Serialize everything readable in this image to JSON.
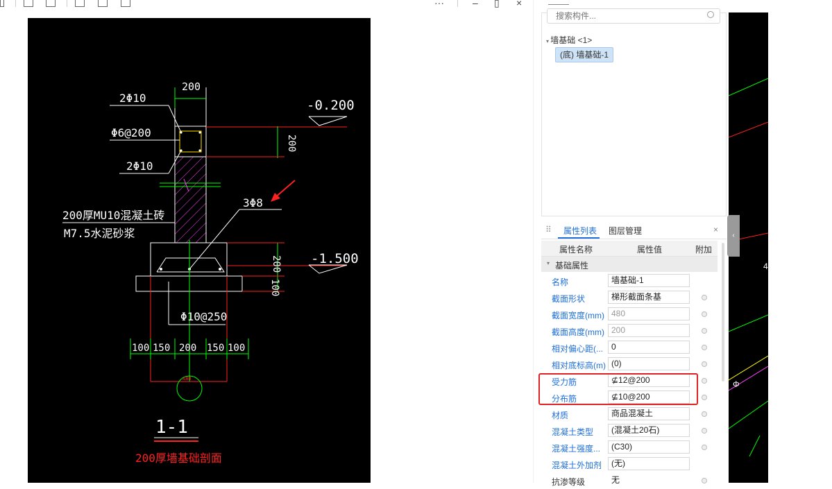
{
  "window": {
    "more": "···",
    "minimize": "–",
    "maximize": "▯",
    "close": "×"
  },
  "drawing": {
    "dim_top": "200",
    "rebar_top": "2Φ10",
    "stirrup": "Φ6@200",
    "rebar_bottom": "2Φ10",
    "elev_top": "-0.200",
    "dim_beam": "200",
    "wall_label_1": "200厚MU10混凝土砖",
    "wall_label_2": "M7.5水泥砂浆",
    "rebar_3": "3Φ8",
    "elev_bottom": "-1.500",
    "dim_footing": "200",
    "dim_cushion": "100",
    "bottom_rebar": "Φ10@250",
    "dims_bottom": [
      "100",
      "150",
      "200",
      "150",
      "100"
    ],
    "section_mark": "1-1",
    "caption": "200厚墙基础剖面",
    "circle_label": "A88"
  },
  "component_panel": {
    "search_placeholder": "搜索构件...",
    "tree_root": "墙基础 <1>",
    "tree_child": "(底) 墙基础-1"
  },
  "props_panel": {
    "tabs": [
      "属性列表",
      "图层管理"
    ],
    "close": "×",
    "columns": [
      "属性名称",
      "属性值",
      "附加"
    ],
    "group": "基础属性",
    "rows": [
      {
        "name": "名称",
        "value": "墙基础-1",
        "dot": false
      },
      {
        "name": "截面形状",
        "value": "梯形截面条基",
        "dot": true
      },
      {
        "name": "截面宽度(mm)",
        "value": "480",
        "dot": true
      },
      {
        "name": "截面高度(mm)",
        "value": "200",
        "dot": true
      },
      {
        "name": "相对偏心距(...",
        "value": "0",
        "dot": true
      },
      {
        "name": "相对底标高(m)",
        "value": "(0)",
        "dot": true
      },
      {
        "name": "受力筋",
        "value": "⊈12@200",
        "dot": true
      },
      {
        "name": "分布筋",
        "value": "⊈10@200",
        "dot": true
      },
      {
        "name": "材质",
        "value": "商品混凝土",
        "dot": true
      },
      {
        "name": "混凝土类型",
        "value": "(混凝土20石)",
        "dot": true
      },
      {
        "name": "混凝土强度...",
        "value": "(C30)",
        "dot": true
      },
      {
        "name": "混凝土外加剂",
        "value": "(无)",
        "dot": false
      },
      {
        "name": "抗渗等级",
        "value": "无",
        "dot": true
      }
    ]
  },
  "colors": {
    "accent": "#1f6fd6",
    "highlight": "#e02020",
    "cad_bg": "#000000"
  }
}
